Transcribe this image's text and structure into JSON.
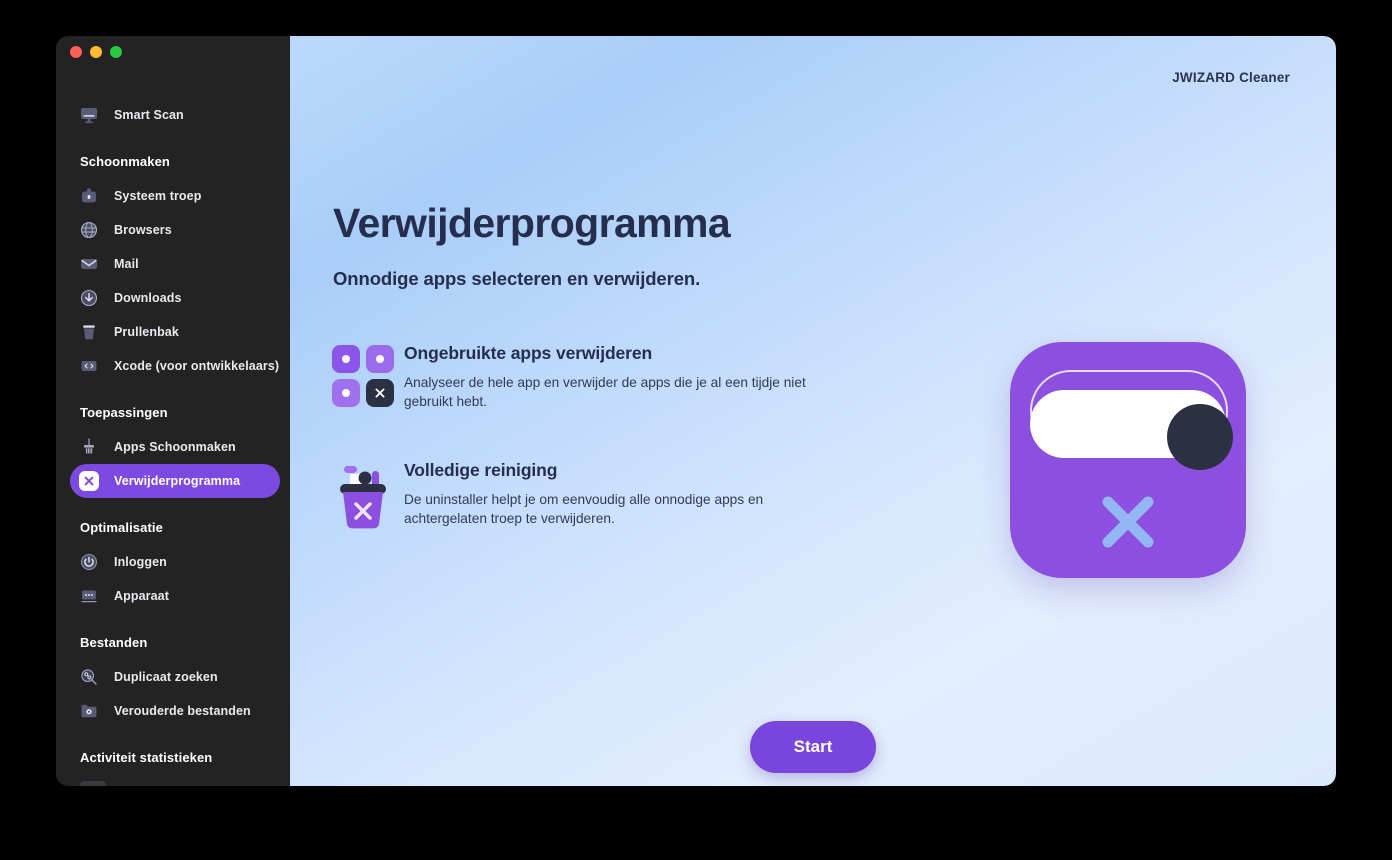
{
  "window": {
    "traffic_lights": [
      "close",
      "minimize",
      "maximize"
    ]
  },
  "brand": "JWIZARD Cleaner",
  "sidebar": {
    "top_item": {
      "label": "Smart Scan",
      "icon": "monitor-icon"
    },
    "sections": [
      {
        "title": "Schoonmaken",
        "items": [
          {
            "label": "Systeem troep",
            "icon": "briefcase-icon",
            "active": false
          },
          {
            "label": "Browsers",
            "icon": "globe-icon",
            "active": false
          },
          {
            "label": "Mail",
            "icon": "envelope-icon",
            "active": false
          },
          {
            "label": "Downloads",
            "icon": "download-icon",
            "active": false
          },
          {
            "label": "Prullenbak",
            "icon": "trash-icon",
            "active": false
          },
          {
            "label": "Xcode (voor ontwikkelaars)",
            "icon": "code-brackets-icon",
            "active": false
          }
        ]
      },
      {
        "title": "Toepassingen",
        "items": [
          {
            "label": "Apps Schoonmaken",
            "icon": "broom-icon",
            "active": false
          },
          {
            "label": "Verwijderprogramma",
            "icon": "x-box-icon",
            "active": true
          }
        ]
      },
      {
        "title": "Optimalisatie",
        "items": [
          {
            "label": "Inloggen",
            "icon": "power-icon",
            "active": false
          },
          {
            "label": "Apparaat",
            "icon": "dots-icon",
            "active": false
          }
        ]
      },
      {
        "title": "Bestanden",
        "items": [
          {
            "label": "Duplicaat zoeken",
            "icon": "magnifier-icon",
            "active": false
          },
          {
            "label": "Verouderde bestanden",
            "icon": "folder-clock-icon",
            "active": false
          }
        ]
      },
      {
        "title": "Activiteit statistieken",
        "items": []
      }
    ]
  },
  "main": {
    "headline": "Verwijderprogramma",
    "subhead": "Onnodige apps selecteren en verwijderen.",
    "features": [
      {
        "title": "Ongebruikte apps verwijderen",
        "description": "Analyseer de hele app en verwijder de apps die je al een tijdje niet gebruikt hebt.",
        "icon": "app-grid-icon"
      },
      {
        "title": "Volledige reiniging",
        "description": "De uninstaller helpt je om eenvoudig alle onnodige apps en achtergelaten troep te verwijderen.",
        "icon": "trash-x-icon"
      }
    ],
    "hero_icon": "uninstaller-toggle-icon",
    "start_button": "Start"
  },
  "colors": {
    "accent_purple": "#7c4ae0",
    "sidebar_bg": "#232323",
    "heading_navy": "#262e4e",
    "hero_purple": "#8c4fe0",
    "traffic_red": "#ff5f57",
    "traffic_yellow": "#febc2e",
    "traffic_green": "#28c840"
  }
}
